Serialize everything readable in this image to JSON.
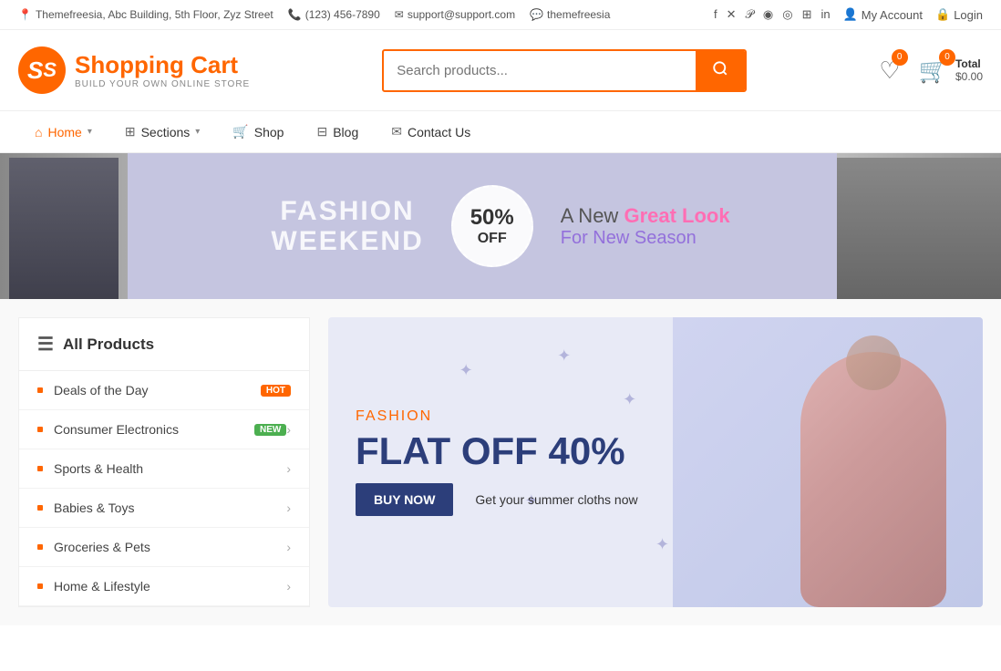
{
  "topbar": {
    "address": "Themefreesia, Abc Building, 5th Floor, Zyz Street",
    "phone": "(123) 456-7890",
    "email": "support@support.com",
    "skype": "themefreesia",
    "account_label": "My Account",
    "login_label": "Login",
    "social": [
      "f",
      "𝕏",
      "𝒫",
      "𝔻",
      "◎",
      "⊞",
      "in"
    ]
  },
  "header": {
    "logo_letter": "S",
    "logo_title": "Shopping Cart",
    "logo_subtitle": "BUILD YOUR OWN ONLINE STORE",
    "search_placeholder": "Search products...",
    "wishlist_count": "0",
    "cart_count": "0",
    "cart_total_label": "Total",
    "cart_total_value": "$0.00"
  },
  "nav": {
    "items": [
      {
        "label": "Home",
        "icon": "home",
        "has_dropdown": true
      },
      {
        "label": "Sections",
        "icon": "sections",
        "has_dropdown": true
      },
      {
        "label": "Shop",
        "icon": "shop",
        "has_dropdown": false
      },
      {
        "label": "Blog",
        "icon": "blog",
        "has_dropdown": false
      },
      {
        "label": "Contact Us",
        "icon": "contact",
        "has_dropdown": false
      }
    ]
  },
  "hero": {
    "text1_line1": "FASHION",
    "text1_line2": "WEEKEND",
    "percent": "50%",
    "off": "OFF",
    "new_label": "A New",
    "great_look": "Great Look",
    "for_new_season": "For New Season"
  },
  "sidebar": {
    "header": "All Products",
    "items": [
      {
        "label": "Deals of the Day",
        "badge": "HOT",
        "badge_type": "hot",
        "has_arrow": false
      },
      {
        "label": "Consumer Electronics",
        "badge": "NEW",
        "badge_type": "new",
        "has_arrow": true
      },
      {
        "label": "Sports & Health",
        "badge": "",
        "badge_type": "",
        "has_arrow": true
      },
      {
        "label": "Babies & Toys",
        "badge": "",
        "badge_type": "",
        "has_arrow": true
      },
      {
        "label": "Groceries & Pets",
        "badge": "",
        "badge_type": "",
        "has_arrow": true
      },
      {
        "label": "Home & Lifestyle",
        "badge": "",
        "badge_type": "",
        "has_arrow": true
      }
    ]
  },
  "feature_banner": {
    "fashion_label": "FASHION",
    "flat_off": "FLAT OFF 40%",
    "buy_now": "BUY NOW",
    "get_text": "Get your summer cloths now"
  }
}
